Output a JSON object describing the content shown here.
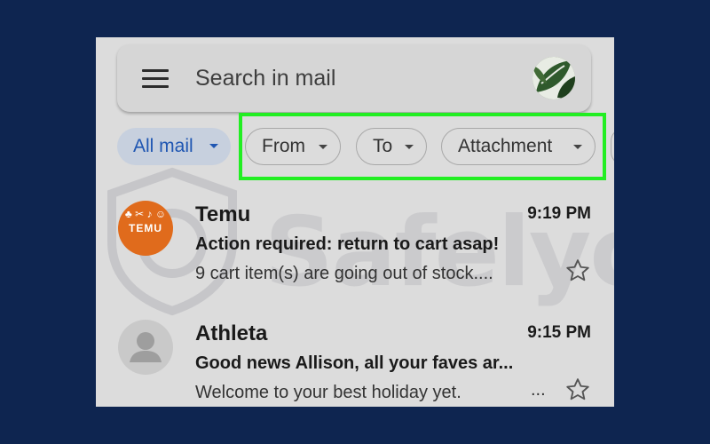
{
  "search": {
    "placeholder": "Search in mail"
  },
  "filters": {
    "all_mail": "All mail",
    "from": "From",
    "to": "To",
    "attachment": "Attachment"
  },
  "emails": [
    {
      "sender": "Temu",
      "time": "9:19 PM",
      "subject": "Action required: return to cart asap!",
      "snippet": "9 cart item(s) are going out of stock....",
      "avatar_label": "TEMU",
      "avatar_color": "#e06b1c"
    },
    {
      "sender": "Athleta",
      "time": "9:15 PM",
      "subject": "Good news Allison, all your faves ar...",
      "snippet": "Welcome to your best holiday yet.",
      "ellipsis": "..."
    }
  ],
  "watermark": "Safelyo",
  "colors": {
    "background": "#0e2550",
    "highlight": "#22ee22",
    "selected_chip": "#1f56b2"
  }
}
